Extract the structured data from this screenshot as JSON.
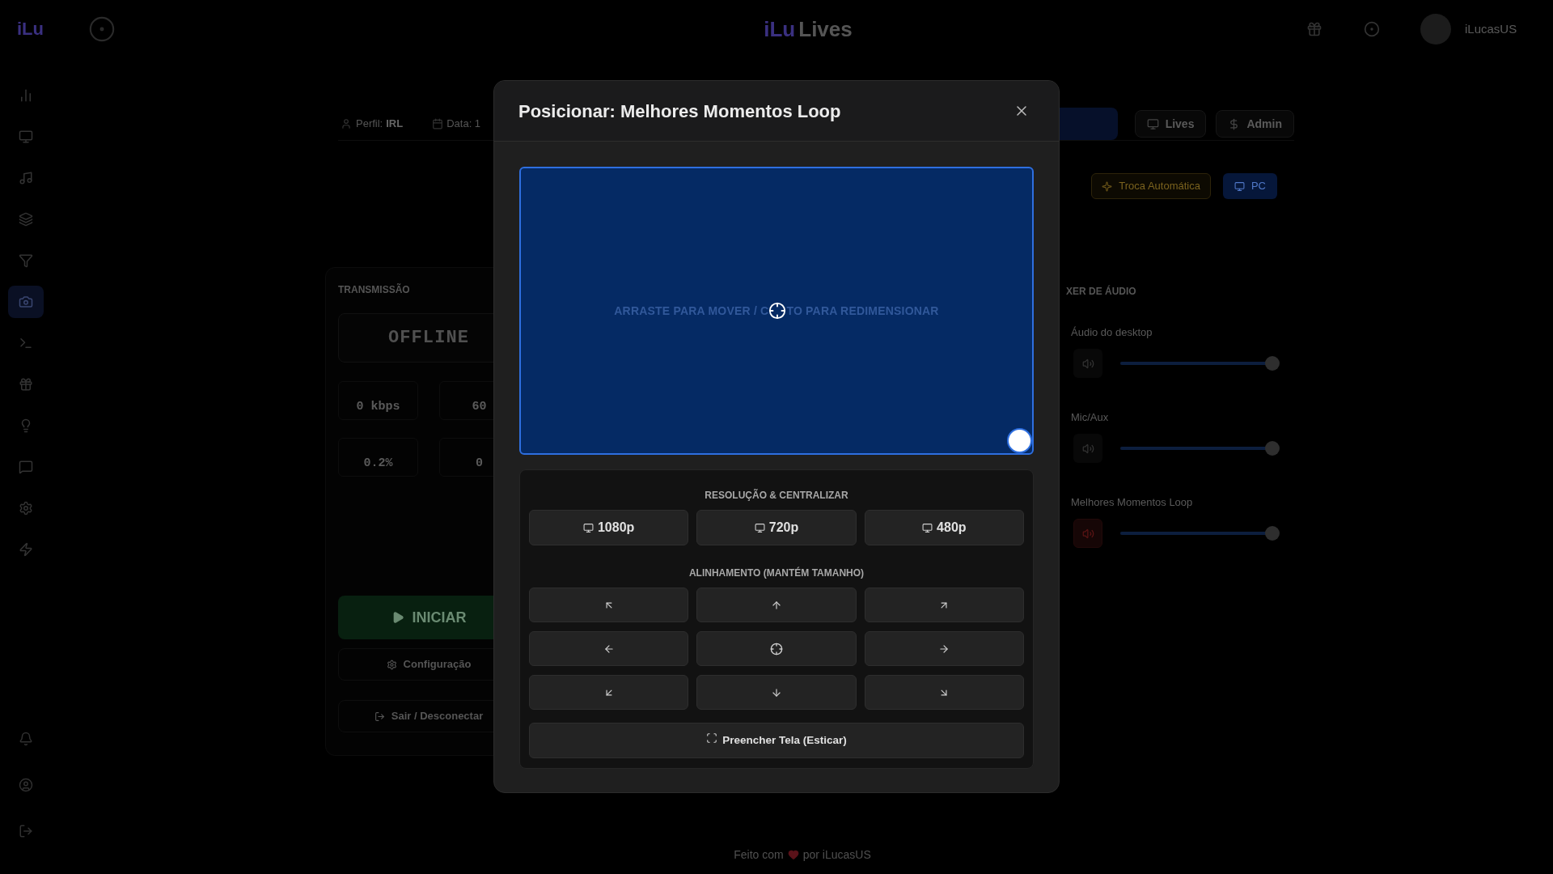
{
  "header": {
    "logo": "iLu",
    "brand": {
      "mark": "iLu",
      "name": "Lives"
    },
    "user": {
      "name": "iLucasUS"
    }
  },
  "sidebar": {
    "items": [
      {
        "selected": false
      },
      {
        "selected": false
      },
      {
        "selected": false
      },
      {
        "selected": false
      },
      {
        "selected": false
      },
      {
        "selected": true
      },
      {
        "selected": false
      },
      {
        "selected": false
      },
      {
        "selected": false
      },
      {
        "selected": false
      },
      {
        "selected": false
      },
      {
        "selected": false
      }
    ]
  },
  "toolbar": {
    "profile": {
      "label": "Perfil:",
      "value": "IRL"
    },
    "date": "Data: 1",
    "nav_buttons": [
      {
        "label": "Lives"
      },
      {
        "label": "Admin"
      }
    ]
  },
  "scene_row": {
    "auto_switch": "Troca Automática",
    "source": {
      "label": "PC",
      "selected": true
    }
  },
  "stream": {
    "title": "TRANSMISSÃO",
    "status": "OFFLINE",
    "stats": [
      {
        "value": "0 kbps"
      },
      {
        "value": "60"
      },
      {
        "value": "0.2%"
      },
      {
        "value": "0"
      }
    ],
    "start_button": "INICIAR",
    "settings_button": "Configuração",
    "disconnect_button": "Sair / Desconectar"
  },
  "mixer": {
    "title": "XER DE ÁUDIO",
    "channels": [
      {
        "name": "Áudio do desktop",
        "muted": false,
        "level": 1
      },
      {
        "name": "Mic/Aux",
        "muted": false,
        "level": 1
      },
      {
        "name": "Melhores Momentos Loop",
        "muted": true,
        "level": 1
      }
    ]
  },
  "dialog": {
    "title": "Posicionar: Melhores Momentos Loop",
    "preview": {
      "hint_left": "ARRASTE PARA MOVER / C",
      "hint_right": "TO PARA REDIMENSIONAR"
    },
    "resolution": {
      "title": "RESOLUÇÃO & CENTRALIZAR",
      "buttons": [
        {
          "label": "1080p"
        },
        {
          "label": "720p"
        },
        {
          "label": "480p"
        }
      ]
    },
    "alignment": {
      "title": "ALINHAMENTO (MANTÉM TAMANHO)"
    },
    "fill_button": "Preencher Tela (Esticar)"
  },
  "footer": {
    "lead": "Feito com",
    "credit": "por iLucasUS"
  }
}
